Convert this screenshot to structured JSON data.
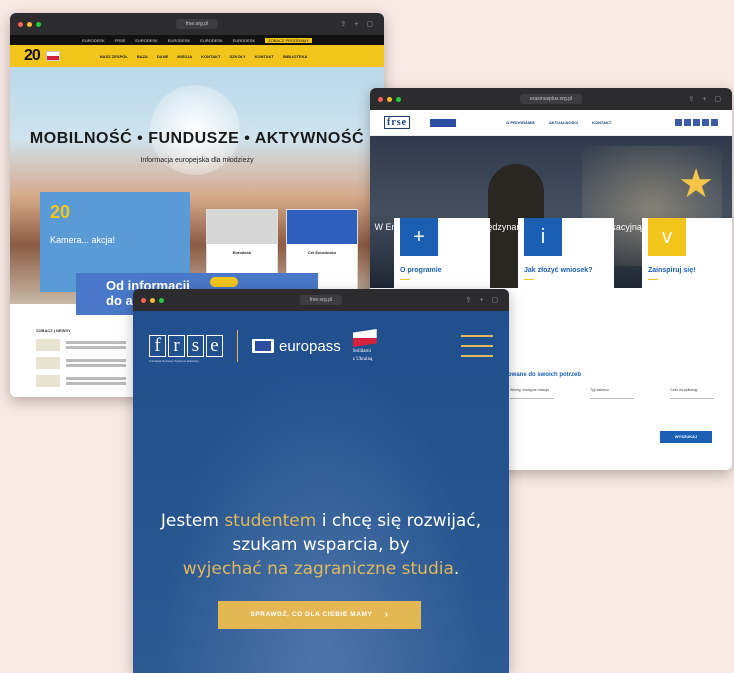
{
  "window_back_left": {
    "url": "frse.org.pl",
    "top_strip": [
      "EURODESK",
      "FRSE",
      "EURODESK",
      "EURODESK",
      "EURODESK",
      "EURODESK",
      "ZOBACZ PROGRAMY"
    ],
    "logo_text": "20",
    "nav": [
      "NASZ ZESPÓŁ",
      "BAZA",
      "DANE",
      "MISSJA",
      "KONTAKT",
      "SZKOŁY",
      "KONTAKT",
      "BIBLIOTEKA"
    ],
    "hero_title": "MOBILNOŚĆ • FUNDUSZE • AKTYWNOŚĆ",
    "hero_subtitle": "Informacja europejska dla młodzieży",
    "feature_card": {
      "badge": "20",
      "title": "Kamera... akcja!"
    },
    "card_2": {
      "title": "Eurodesk"
    },
    "card_3": {
      "title": "Cel Eurodesku"
    },
    "banner": {
      "line1": "Od informacji",
      "line2": "do ak"
    },
    "news_header": "ZOBACZ | NEWSY"
  },
  "window_right": {
    "url": "erasmusplus.org.pl",
    "logo_text": "frse",
    "header_links": [
      "O PROGRAMIE",
      "AKTUALNOŚCI",
      "KONTAKT"
    ],
    "hero_text_pre": "W Erasmus+",
    "hero_text_highlight": "wspieramy",
    "hero_text_mid": "międzynarodową współpracę edukacyjną. Otwórz się na",
    "hero_text_highlight2": "nowe możliwości!",
    "cards": [
      {
        "icon": "+",
        "title": "O programie"
      },
      {
        "icon": "i",
        "title": "Jak złożyć wniosek?"
      },
      {
        "icon": "v",
        "title": "Zainspiruj się!"
      }
    ],
    "match_title": "opasowane do swoich potrzeb",
    "form_labels": [
      "Wiemy, dostępne dotacje",
      "Typ zakresu",
      "Czas na aplikację"
    ],
    "search_label": "WYSZUKAJ"
  },
  "window_front": {
    "url": "frse.org.pl",
    "logo_letters": [
      "f",
      "r",
      "s",
      "e"
    ],
    "logo_caption": "Fundacja Rozwoju Systemu Edukacji",
    "europass": "europass",
    "solidarity_line1": "Solidarni",
    "solidarity_line2": "z Ukrainą",
    "headline_1": "Jestem",
    "headline_hl1": "studentem",
    "headline_2": "i chcę się rozwijać, szukam wsparcia, by",
    "headline_hl2": "wyjechać na zagraniczne studia",
    "headline_end": ".",
    "cta_label": "SPRAWDŹ, CO DLA CIEBIE MAMY"
  },
  "colors": {
    "background": "#f9e9e4",
    "frse_blue": "#1f4d8c",
    "gold": "#e3b854",
    "eurodesk_yellow": "#f2c51c",
    "erasmus_blue": "#1a5fb4"
  }
}
